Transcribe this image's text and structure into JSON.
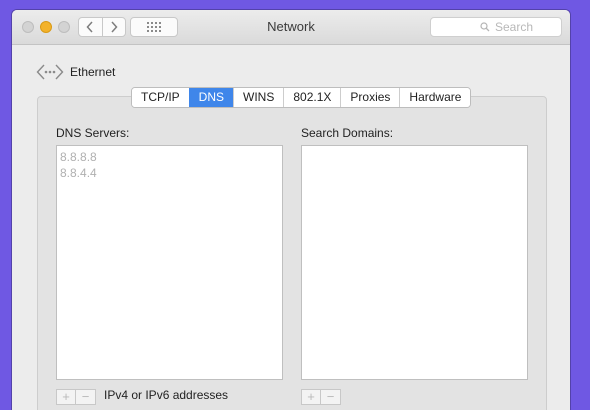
{
  "window": {
    "title": "Network",
    "search_placeholder": "Search"
  },
  "interface": {
    "name": "Ethernet"
  },
  "tabs": [
    {
      "label": "TCP/IP"
    },
    {
      "label": "DNS",
      "active": true
    },
    {
      "label": "WINS"
    },
    {
      "label": "802.1X"
    },
    {
      "label": "Proxies"
    },
    {
      "label": "Hardware"
    }
  ],
  "dns": {
    "label": "DNS Servers:",
    "servers": [
      "8.8.8.8",
      "8.8.4.4"
    ],
    "add_label": "+",
    "remove_label": "−",
    "hint": "IPv4 or IPv6 addresses"
  },
  "search_domains": {
    "label": "Search Domains:",
    "add_label": "+",
    "remove_label": "−"
  },
  "colors": {
    "background": "#6f58e3",
    "accent": "#3f86ea",
    "minimize": "#f3b22a"
  }
}
